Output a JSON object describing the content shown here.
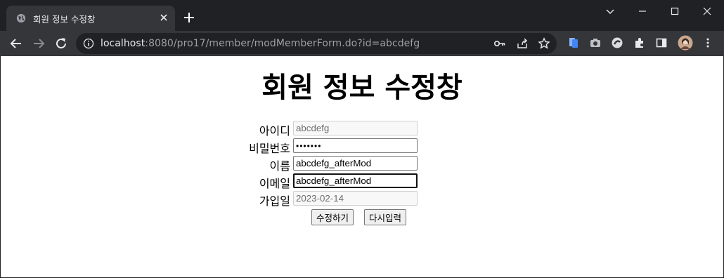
{
  "browser": {
    "tab": {
      "title": "회원 정보 수정창",
      "favicon": "globe-icon"
    },
    "omnibox": {
      "host": "localhost",
      "path": ":8080/pro17/member/modMemberForm.do?id=abcdefg"
    },
    "colors": {
      "frame": "#202124",
      "toolbar": "#35363a",
      "text": "#e8eaed"
    }
  },
  "page": {
    "title": "회원 정보 수정창",
    "fields": [
      {
        "label": "아이디",
        "value": "abcdefg",
        "state": "readonly"
      },
      {
        "label": "비밀번호",
        "value": "•••••••",
        "state": "password"
      },
      {
        "label": "이름",
        "value": "abcdefg_afterMod",
        "state": "editable"
      },
      {
        "label": "이메일",
        "value": "abcdefg_afterMod",
        "state": "focused"
      },
      {
        "label": "가입일",
        "value": "2023-02-14",
        "state": "readonly"
      }
    ],
    "buttons": {
      "submit": "수정하기",
      "reset": "다시입력"
    }
  }
}
